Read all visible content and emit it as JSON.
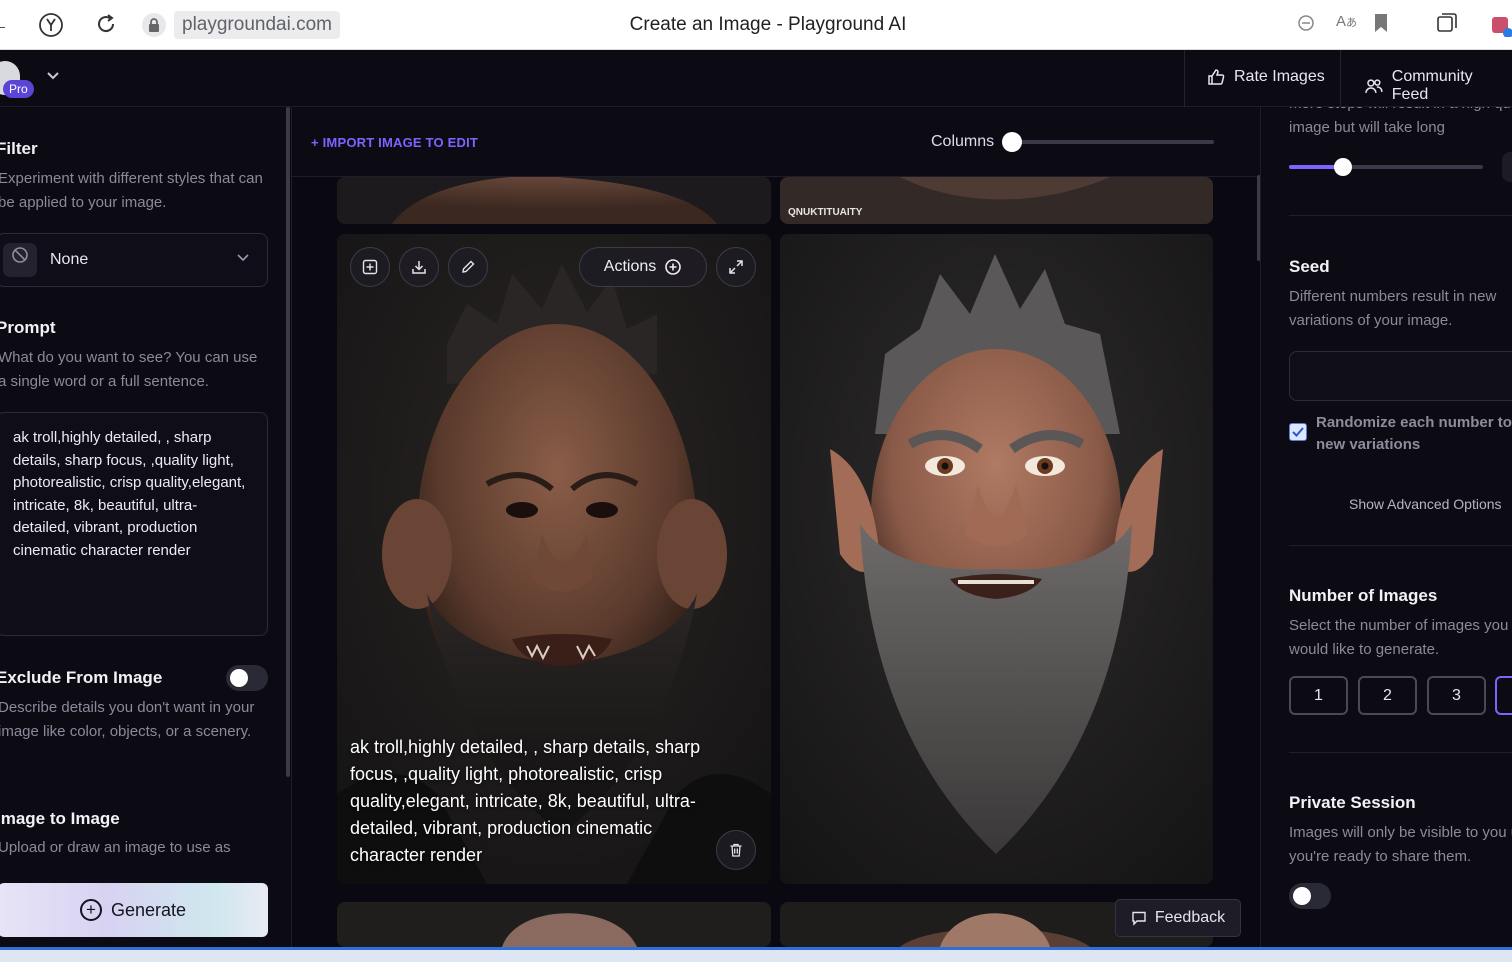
{
  "browser": {
    "url": "playgroundai.com",
    "tab_title": "Create an Image - Playground AI"
  },
  "appbar": {
    "pro_badge": "Pro",
    "rate_images": "Rate Images",
    "community_feed": "Community Feed"
  },
  "left": {
    "filter": {
      "title": "Filter",
      "desc": "Experiment with different styles that can be applied to your image.",
      "selected": "None"
    },
    "prompt": {
      "title": "Prompt",
      "desc": "What do you want to see? You can use a single word or a full sentence.",
      "value": "ak troll,highly detailed, , sharp details, sharp focus, ,quality light, photorealistic, crisp quality,elegant, intricate, 8k, beautiful, ultra-detailed, vibrant, production cinematic character render"
    },
    "exclude": {
      "title": "Exclude From Image",
      "desc": "Describe details you don't want in your image like color, objects, or a scenery.",
      "enabled": false
    },
    "img2img": {
      "title": "Image to Image",
      "desc": "Upload or draw an image to use as"
    },
    "generate_label": "Generate"
  },
  "center": {
    "import_label": "+ IMPORT IMAGE TO EDIT",
    "columns_label": "Columns",
    "columns_level": 0,
    "watermark_text": "QNUKTITUAITY",
    "actions_label": "Actions",
    "caption": "ak troll,highly detailed, , sharp details, sharp focus, ,quality light, photorealistic, crisp quality,elegant, intricate, 8k, beautiful, ultra-detailed, vibrant, production cinematic character render",
    "feedback_label": "Feedback"
  },
  "right": {
    "steps_desc": "more steps will result in a high quality image but will take long",
    "seed": {
      "title": "Seed",
      "desc": "Different numbers result in new variations of your image.",
      "randomize_label": "Randomize each number to new variations",
      "randomize_checked": true
    },
    "advanced_label": "Show Advanced Options",
    "num_images": {
      "title": "Number of Images",
      "desc": "Select the number of images you would like to generate.",
      "options": [
        "1",
        "2",
        "3"
      ]
    },
    "private": {
      "title": "Private Session",
      "desc": "Images will only be visible to you until you're ready to share them.",
      "enabled": false
    }
  },
  "colors": {
    "accent": "#7d63ff",
    "background": "#0a0912",
    "panel": "#0c0b14"
  }
}
